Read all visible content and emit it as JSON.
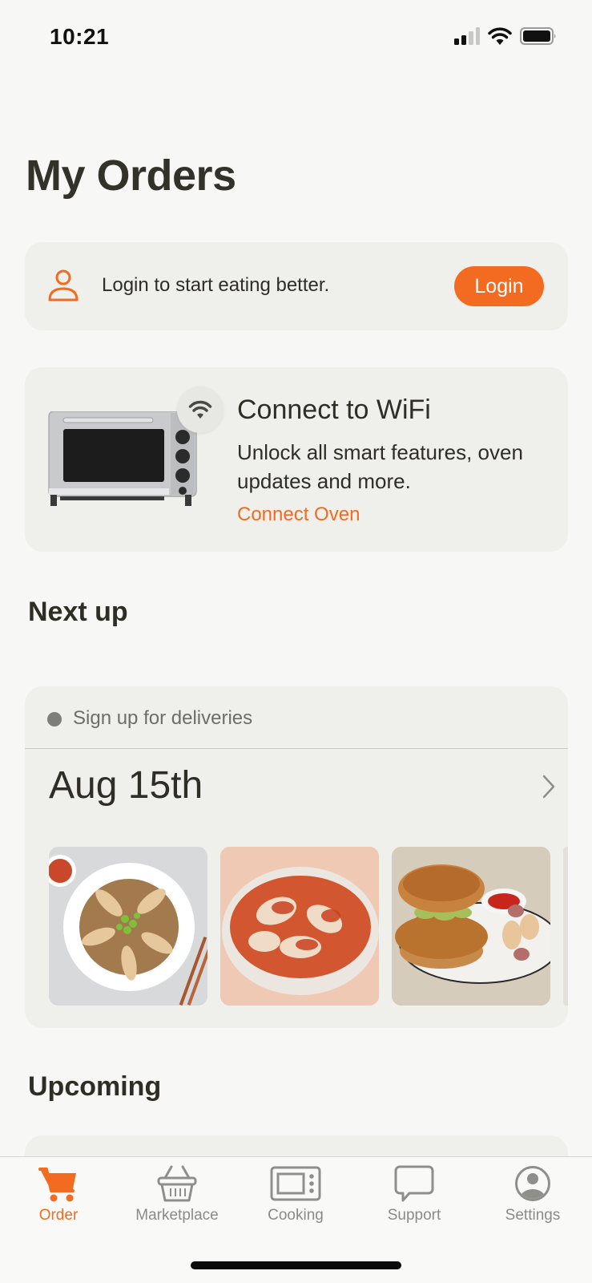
{
  "status_bar": {
    "time": "10:21",
    "signal_icon": "cellular-signal-icon",
    "wifi_icon": "wifi-icon",
    "battery_icon": "battery-icon"
  },
  "page": {
    "title": "My Orders"
  },
  "login_card": {
    "icon": "user-icon",
    "text": "Login to start eating better.",
    "button_label": "Login"
  },
  "wifi_card": {
    "image": "oven-image",
    "badge_icon": "wifi-icon",
    "title": "Connect to WiFi",
    "description": "Unlock all smart features, oven updates and more.",
    "link_label": "Connect Oven"
  },
  "next_up": {
    "section_title": "Next up",
    "status_text": "Sign up for deliveries",
    "date": "Aug 15th",
    "meals": [
      {
        "name": "dumplings-fried-rice-image"
      },
      {
        "name": "dumplings-tomato-sauce-image"
      },
      {
        "name": "chicken-sandwich-image"
      }
    ]
  },
  "upcoming": {
    "section_title": "Upcoming"
  },
  "tabbar": {
    "items": [
      {
        "label": "Order",
        "icon": "cart-icon",
        "active": true
      },
      {
        "label": "Marketplace",
        "icon": "basket-icon",
        "active": false
      },
      {
        "label": "Cooking",
        "icon": "oven-icon",
        "active": false
      },
      {
        "label": "Support",
        "icon": "chat-bubble-icon",
        "active": false
      },
      {
        "label": "Settings",
        "icon": "profile-icon",
        "active": false
      }
    ]
  },
  "colors": {
    "accent": "#f26b21",
    "background": "#f7f7f5",
    "card": "#efefeb",
    "text": "#2e2d26",
    "muted": "#8a8a86"
  }
}
